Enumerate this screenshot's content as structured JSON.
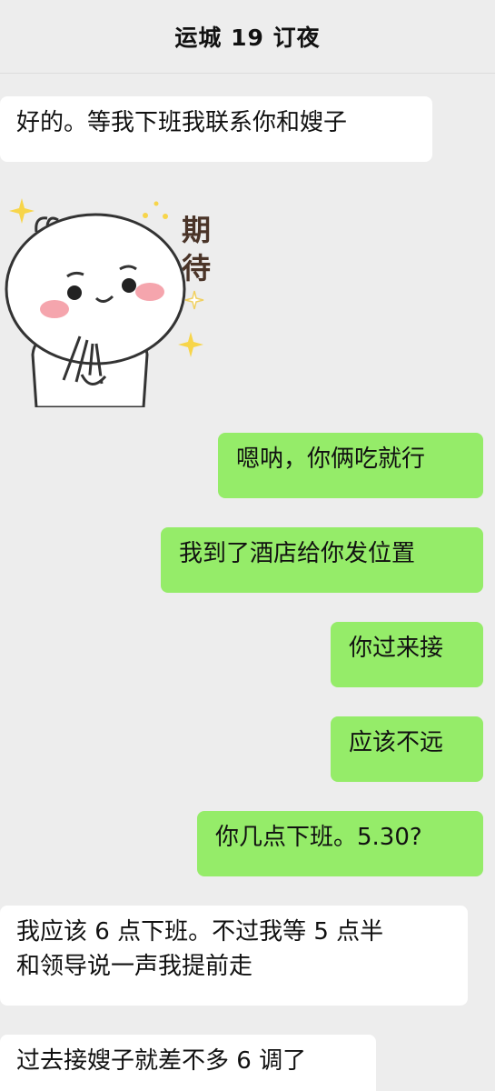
{
  "header": {
    "title": "运城 19 订夜"
  },
  "messages": [
    {
      "side": "incoming",
      "text": "好的。等我下班我联系你和嫂子"
    },
    {
      "side": "incoming",
      "type": "sticker",
      "sticker_text": "期待"
    },
    {
      "side": "outgoing",
      "text": "嗯呐，你俩吃就行"
    },
    {
      "side": "outgoing",
      "text": "我到了酒店给你发位置"
    },
    {
      "side": "outgoing",
      "text": "你过来接"
    },
    {
      "side": "outgoing",
      "text": "应该不远"
    },
    {
      "side": "outgoing",
      "text": "你几点下班。5.30?"
    },
    {
      "side": "incoming",
      "lines": [
        "我应该 6 点下班。不过我等 5 点半",
        "和领导说一声我提前走"
      ]
    },
    {
      "side": "incoming",
      "text": "过去接嫂子就差不多 6 调了"
    }
  ],
  "colors": {
    "background": "#ededed",
    "incoming_bubble": "#ffffff",
    "outgoing_bubble": "#95ec69"
  }
}
